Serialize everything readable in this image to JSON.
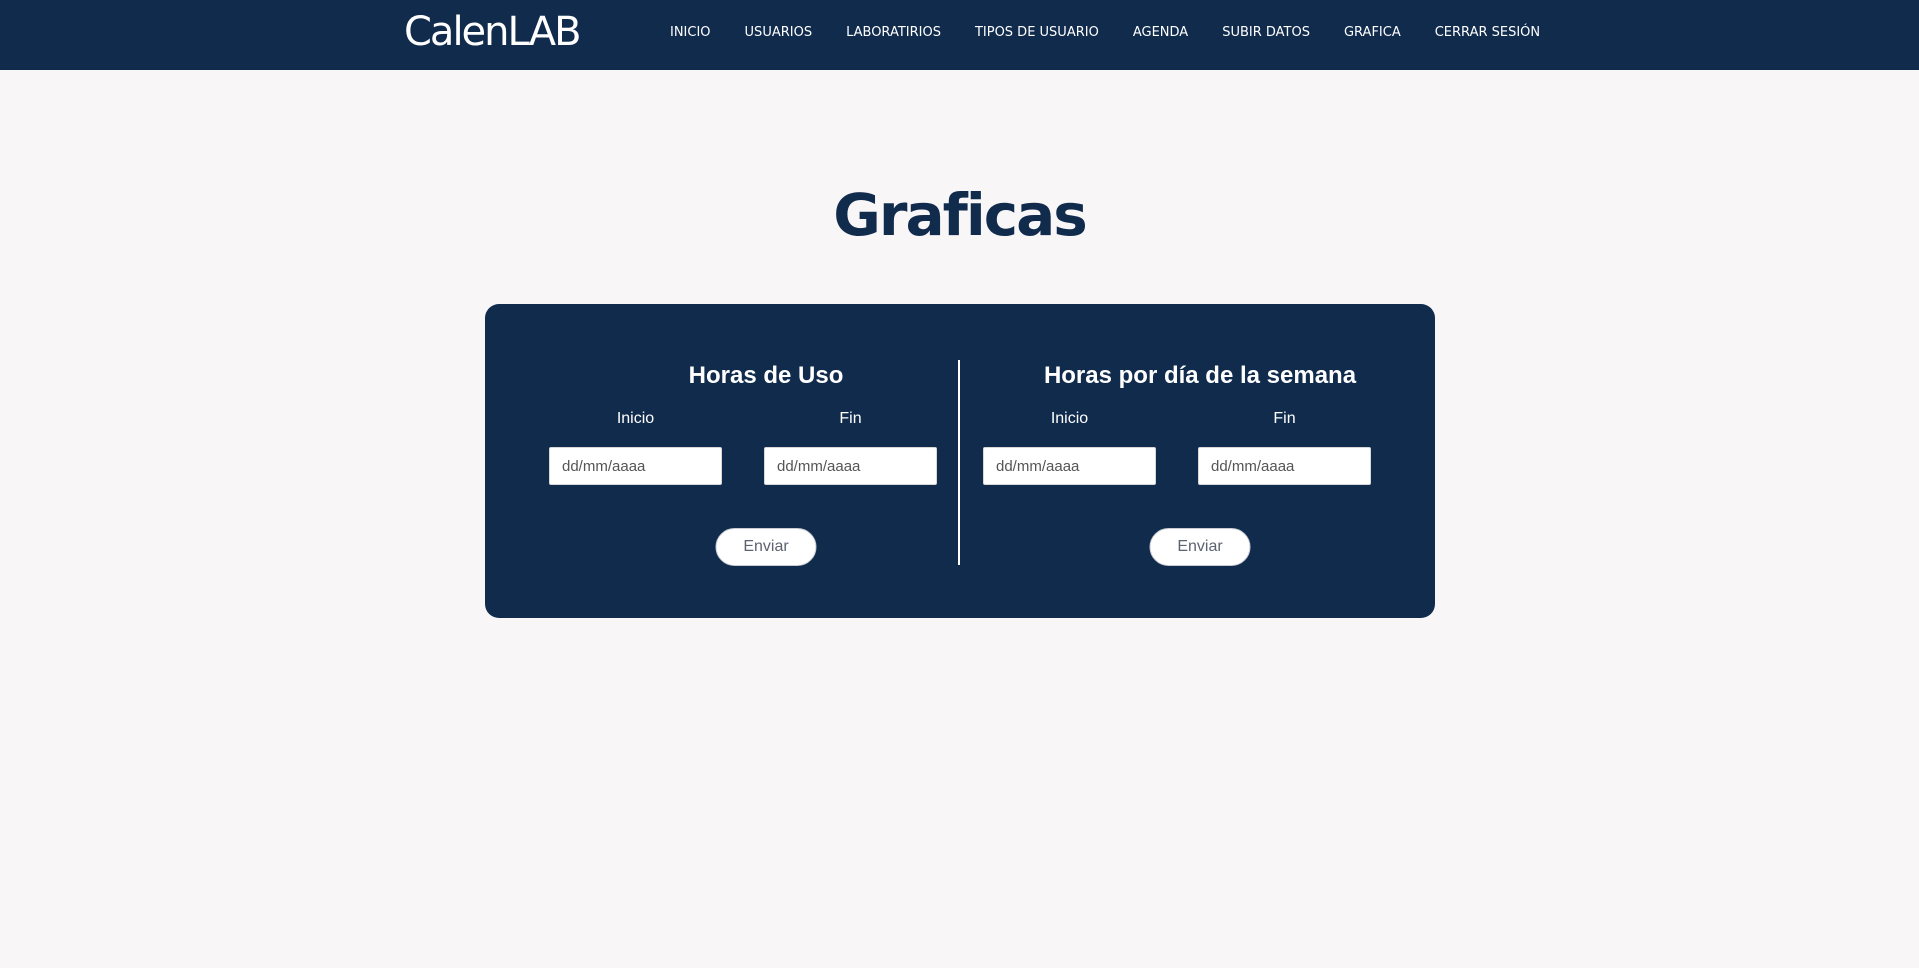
{
  "brand": "CalenLAB",
  "nav": [
    "INICIO",
    "USUARIOS",
    "LABORATIRIOS",
    "TIPOS DE USUARIO",
    "AGENDA",
    "SUBIR DATOS",
    "GRAFICA",
    "CERRAR SESIÓN"
  ],
  "page_title": "Graficas",
  "sections": [
    {
      "title": "Horas de Uso",
      "start_label": "Inicio",
      "end_label": "Fin",
      "start_placeholder": "dd/mm/aaaa",
      "end_placeholder": "dd/mm/aaaa",
      "submit_label": "Enviar"
    },
    {
      "title": "Horas por día de la semana",
      "start_label": "Inicio",
      "end_label": "Fin",
      "start_placeholder": "dd/mm/aaaa",
      "end_placeholder": "dd/mm/aaaa",
      "submit_label": "Enviar"
    }
  ],
  "colors": {
    "primary": "#112b4d",
    "background": "#f8f6f7",
    "text_light": "#ffffff"
  }
}
